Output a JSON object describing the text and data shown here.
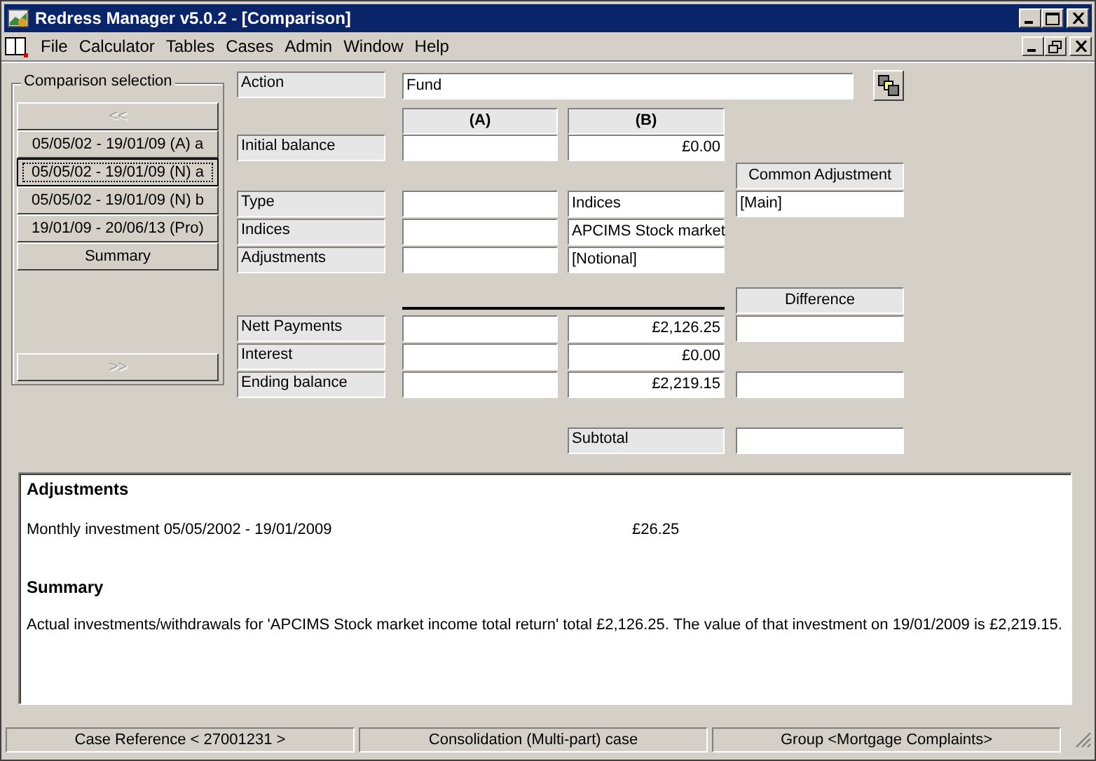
{
  "window": {
    "title": "Redress Manager v5.0.2 - [Comparison]"
  },
  "menu": [
    "File",
    "Calculator",
    "Tables",
    "Cases",
    "Admin",
    "Window",
    "Help"
  ],
  "selection": {
    "title": "Comparison selection",
    "prev": {
      "label": "<<",
      "disabled": true
    },
    "next": {
      "label": ">>",
      "disabled": true
    },
    "items": [
      {
        "label": "05/05/02 - 19/01/09 (A) a",
        "selected": false
      },
      {
        "label": "05/05/02 - 19/01/09 (N) a",
        "selected": true
      },
      {
        "label": "05/05/02 - 19/01/09 (N) b",
        "selected": false
      },
      {
        "label": "19/01/09 - 20/06/13 (Pro)",
        "selected": false
      },
      {
        "label": "Summary",
        "selected": false
      }
    ]
  },
  "form": {
    "action_label": "Action",
    "action_value": "Fund",
    "column_headers": [
      "(A)",
      "(B)"
    ],
    "common_header": "Common Adjustment",
    "difference_header": "Difference",
    "rows": [
      {
        "label": "Initial balance",
        "kind": "amount",
        "b": "£0.00",
        "c_field": false
      },
      {
        "label": "Type",
        "kind": "text",
        "b": "Indices",
        "c": "[Main]",
        "c_field": true
      },
      {
        "label": "Indices",
        "kind": "text",
        "b": "APCIMS Stock market",
        "c_field": false
      },
      {
        "label": "Adjustments",
        "kind": "text",
        "b": " [Notional]",
        "c_field": false
      },
      {
        "label": "Nett Payments",
        "kind": "amount",
        "b": "£2,126.25",
        "c_field": true
      },
      {
        "label": "Interest",
        "kind": "amount",
        "b": "£0.00",
        "c_field": false
      },
      {
        "label": "Ending balance",
        "kind": "amount",
        "b": "£2,219.15",
        "c_field": true
      }
    ],
    "subtotal_label": "Subtotal"
  },
  "report": {
    "adjustments_heading": "Adjustments",
    "adjustment_lines": [
      {
        "text": "Monthly investment 05/05/2002 - 19/01/2009",
        "amount": "£26.25"
      }
    ],
    "summary_heading": "Summary",
    "summary_text": "Actual investments/withdrawals for 'APCIMS Stock market income total return' total £2,126.25. The value of that investment on 19/01/2009 is £2,219.15."
  },
  "status_bar": [
    "Case Reference < 27001231 >",
    "Consolidation (Multi-part) case",
    "Group <Mortgage Complaints>"
  ]
}
